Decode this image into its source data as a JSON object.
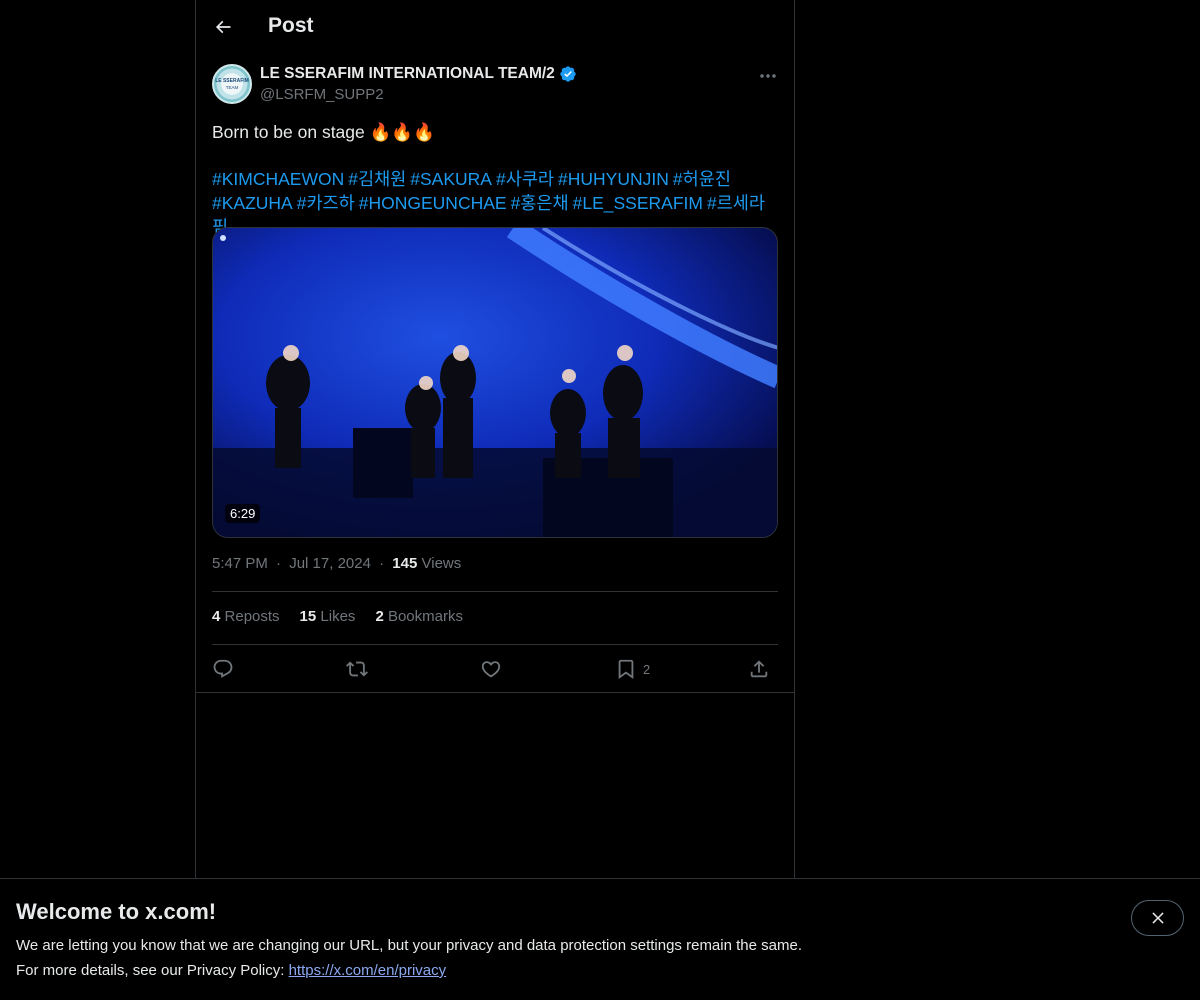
{
  "header": {
    "title": "Post"
  },
  "author": {
    "display_name": "LE SSERAFIM INTERNATIONAL TEAM/2",
    "handle": "@LSRFM_SUPP2",
    "verified": true,
    "avatar_text": "LE SSERAFIM TEAM"
  },
  "tweet": {
    "text": "Born to be on stage 🔥🔥🔥",
    "hashtags_line1": [
      "#KIMCHAEWON",
      "#김채원",
      "#SAKURA",
      "#사쿠라",
      "#HUHYUNJIN",
      "#허윤진"
    ],
    "hashtags_line2": [
      "#KAZUHA",
      "#카즈하",
      "#HONGEUNCHAE",
      "#홍은채",
      "#LE_SSERAFIM",
      "#르세라핌"
    ],
    "video_duration": "6:29"
  },
  "meta": {
    "time": "5:47 PM",
    "date": "Jul 17, 2024",
    "separator": "·",
    "views_count": "145",
    "views_label": "Views"
  },
  "stats": {
    "reposts_count": "4",
    "reposts_label": "Reposts",
    "likes_count": "15",
    "likes_label": "Likes",
    "bookmarks_count": "2",
    "bookmarks_label": "Bookmarks"
  },
  "actions": {
    "bookmark_count": "2"
  },
  "banner": {
    "title": "Welcome to x.com!",
    "line1": "We are letting you know that we are changing our URL, but your privacy and data protection settings remain the same.",
    "line2_prefix": "For more details, see our Privacy Policy: ",
    "link": "https://x.com/en/privacy"
  },
  "colors": {
    "accent": "#1d9bf0",
    "background": "#000000",
    "muted": "#71767b",
    "text": "#e7e9ea",
    "border": "#2f3336"
  }
}
